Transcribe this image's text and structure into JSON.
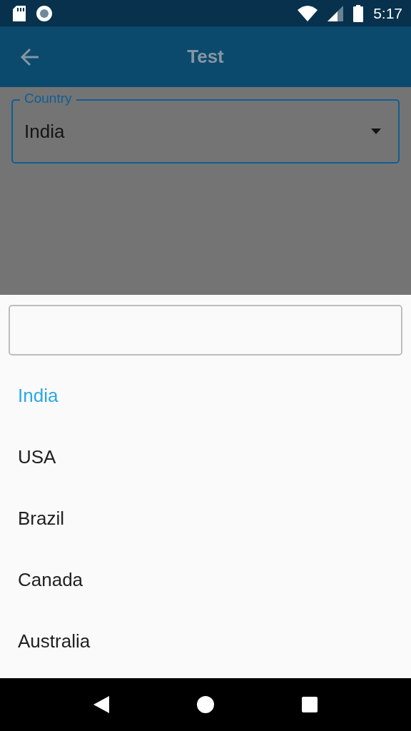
{
  "status_bar": {
    "time": "5:17"
  },
  "app_bar": {
    "title": "Test"
  },
  "country_field": {
    "label": "Country",
    "value": "India"
  },
  "picker": {
    "options": [
      {
        "label": "India",
        "selected": true
      },
      {
        "label": "USA",
        "selected": false
      },
      {
        "label": "Brazil",
        "selected": false
      },
      {
        "label": "Canada",
        "selected": false
      },
      {
        "label": "Australia",
        "selected": false
      }
    ]
  }
}
